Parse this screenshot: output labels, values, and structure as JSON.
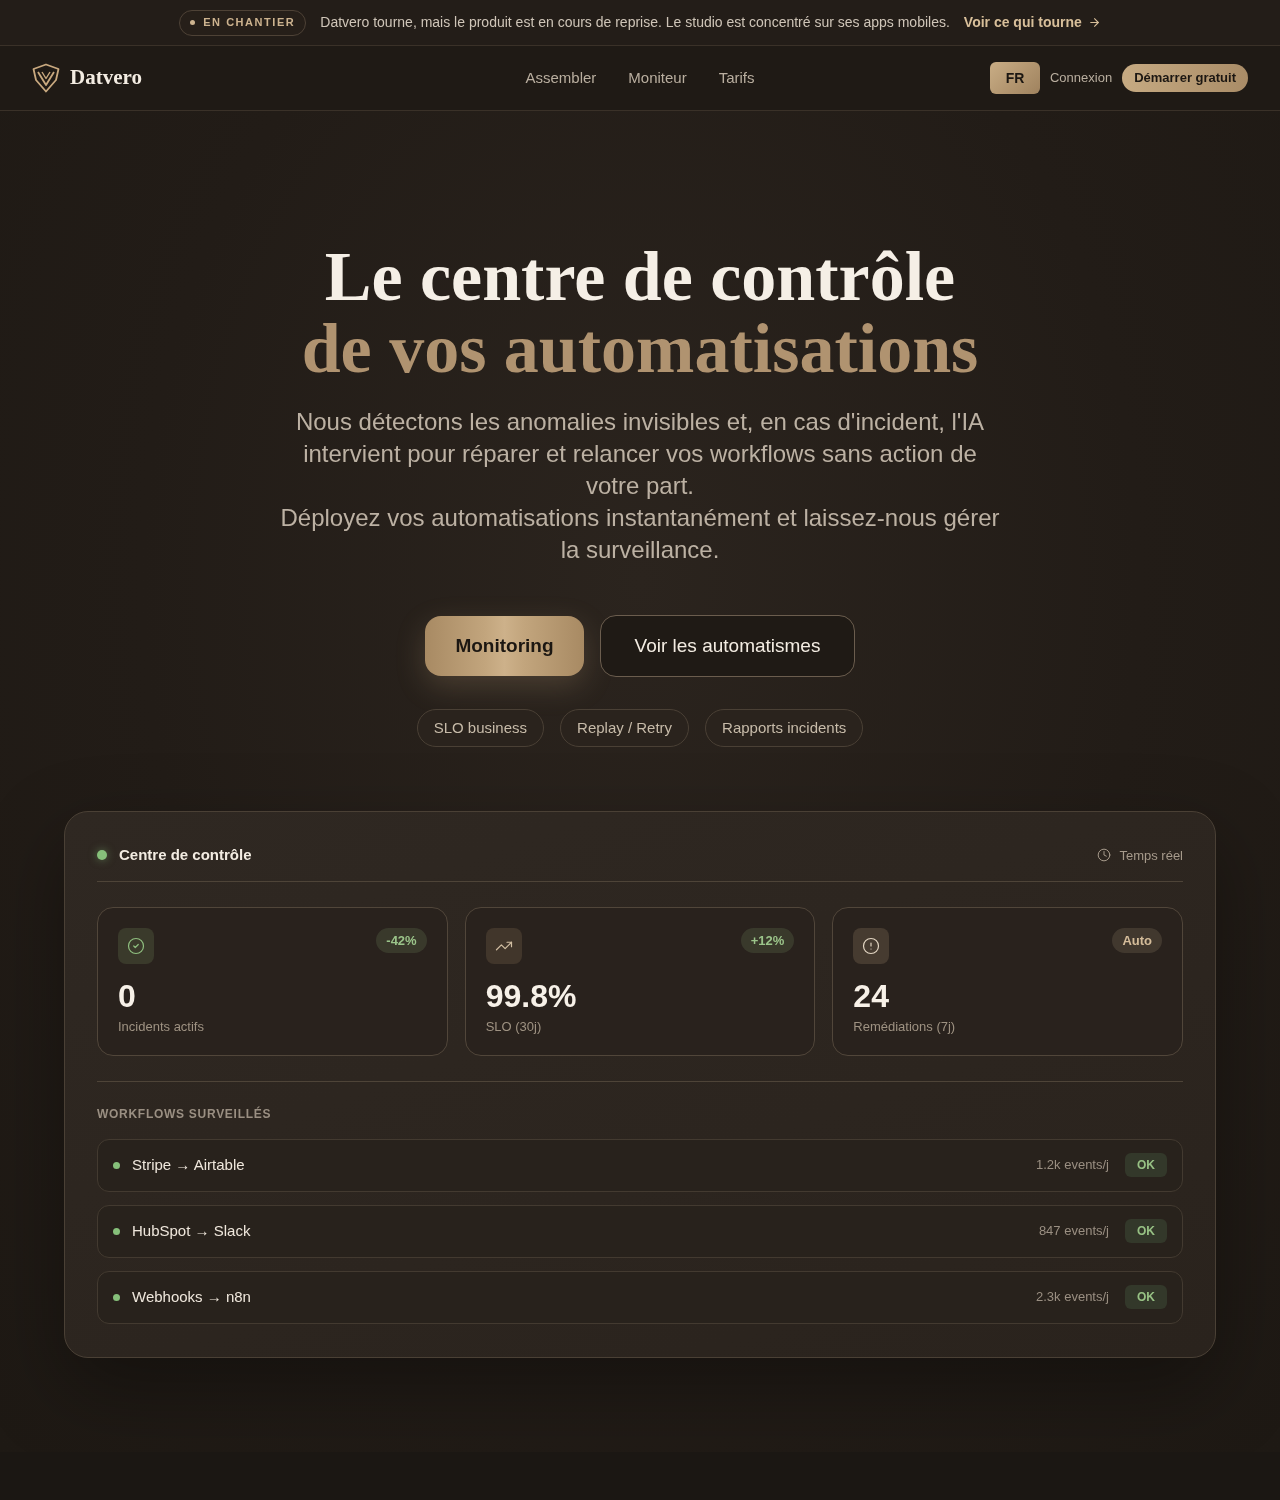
{
  "announcement": {
    "badge": "EN CHANTIER",
    "message": "Datvero tourne, mais le produit est en cours de reprise. Le studio est concentré sur ses apps mobiles.",
    "link": "Voir ce qui tourne"
  },
  "nav": {
    "brand": "Datvero",
    "links": [
      "Assembler",
      "Moniteur",
      "Tarifs"
    ],
    "language": "FR",
    "login": "Connexion",
    "cta": "Démarrer gratuit"
  },
  "hero": {
    "title": {
      "main": "Le centre de contrôle",
      "accent": "de vos automatisations"
    },
    "paragraphs": [
      "Nous détectons les anomalies invisibles et, en cas d'incident, l'IA intervient pour réparer et relancer vos workflows sans action de votre part.",
      "Déployez vos automatisations instantanément et laissez-nous gérer la surveillance."
    ],
    "buttons": [
      {
        "label": "Monitoring",
        "kind": "primary"
      },
      {
        "label": "Voir les automatismes",
        "kind": "secondary"
      }
    ],
    "chips": [
      "SLO business",
      "Replay / Retry",
      "Rapports incidents"
    ]
  },
  "dashboard": {
    "title": "Centre de contrôle",
    "live_label": "Temps réel",
    "metrics": [
      {
        "kind": "success",
        "value": "0",
        "label": "Incidents actifs",
        "badge": {
          "text": "-42%",
          "color": "#9bc48a"
        }
      },
      {
        "kind": "trend",
        "value": "99.8%",
        "label": "SLO (30j)",
        "badge": {
          "text": "+12%",
          "color": "#9bc48a"
        }
      },
      {
        "kind": "alert",
        "value": "24",
        "label": "Remédiations (7j)",
        "badge": {
          "text": "Auto",
          "color": "#d4bc9a"
        }
      }
    ],
    "section_title": "WORKFLOWS SURVEILLÉS",
    "workflows": [
      {
        "name": "Stripe → Airtable",
        "color": "#86c07a",
        "volume": "1.2k events/j",
        "status": "OK"
      },
      {
        "name": "HubSpot → Slack",
        "color": "#86c07a",
        "volume": "847 events/j",
        "status": "OK"
      },
      {
        "name": "Webhooks → n8n",
        "color": "#86c07a",
        "volume": "2.3k events/j",
        "status": "OK"
      }
    ]
  }
}
